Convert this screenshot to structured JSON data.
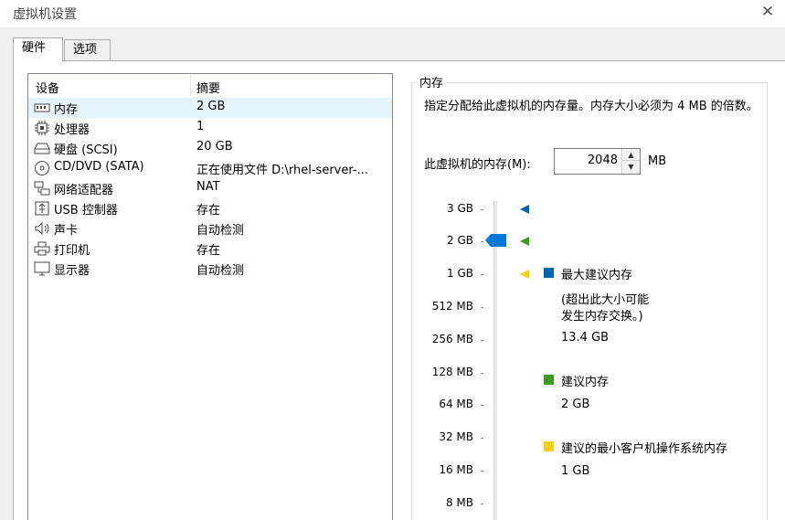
{
  "window": {
    "title": "虚拟机设置",
    "close_label": "✕"
  },
  "tabs": [
    {
      "label": "硬件",
      "active": true
    },
    {
      "label": "选项",
      "active": false
    }
  ],
  "device_table": {
    "headers": [
      "设备",
      "摘要"
    ],
    "rows": [
      {
        "name": "内存",
        "summary": "2 GB",
        "icon": "memory-icon"
      },
      {
        "name": "处理器",
        "summary": "1",
        "icon": "processor-icon"
      },
      {
        "name": "硬盘 (SCSI)",
        "summary": "20 GB",
        "icon": "hard-disk-icon"
      },
      {
        "name": "CD/DVD (SATA)",
        "summary": "正在使用文件 D:\\rhel-server-...",
        "icon": "cd-dvd-icon"
      },
      {
        "name": "网络适配器",
        "summary": "NAT",
        "icon": "network-adapter-icon"
      },
      {
        "name": "USB 控制器",
        "summary": "存在",
        "icon": "usb-icon"
      },
      {
        "name": "声卡",
        "summary": "自动检测",
        "icon": "speaker-icon"
      },
      {
        "name": "打印机",
        "summary": "存在",
        "icon": "printer-icon"
      },
      {
        "name": "显示器",
        "summary": "自动检测",
        "icon": "monitor-icon"
      }
    ]
  },
  "memory": {
    "group_title": "内存",
    "description": "指定分配给此虚拟机的内存量。内存大小必须为 4 MB 的倍数。",
    "field_label": "此虚拟机的内存(M):",
    "value": "2048",
    "unit": "MB",
    "scale_labels": [
      "3 GB",
      "2 GB",
      "1 GB",
      "512 MB",
      "256 MB",
      "128 MB",
      "64 MB",
      "32 MB",
      "16 MB",
      "8 MB"
    ],
    "legend": {
      "max_title": "最大建议内存",
      "max_note_line1": "(超出此大小可能",
      "max_note_line2": "发生内存交换。)",
      "max_value": "13.4 GB",
      "rec_title": "建议内存",
      "rec_value": "2 GB",
      "min_title": "建议的最小客户机操作系统内存",
      "min_value": "1 GB"
    }
  },
  "colors": {
    "max": "#0064b4",
    "recommended": "#3c9b1e",
    "minimum": "#f5d20a",
    "thumb": "#0078d7",
    "selected_row": "#e5f3fb"
  }
}
